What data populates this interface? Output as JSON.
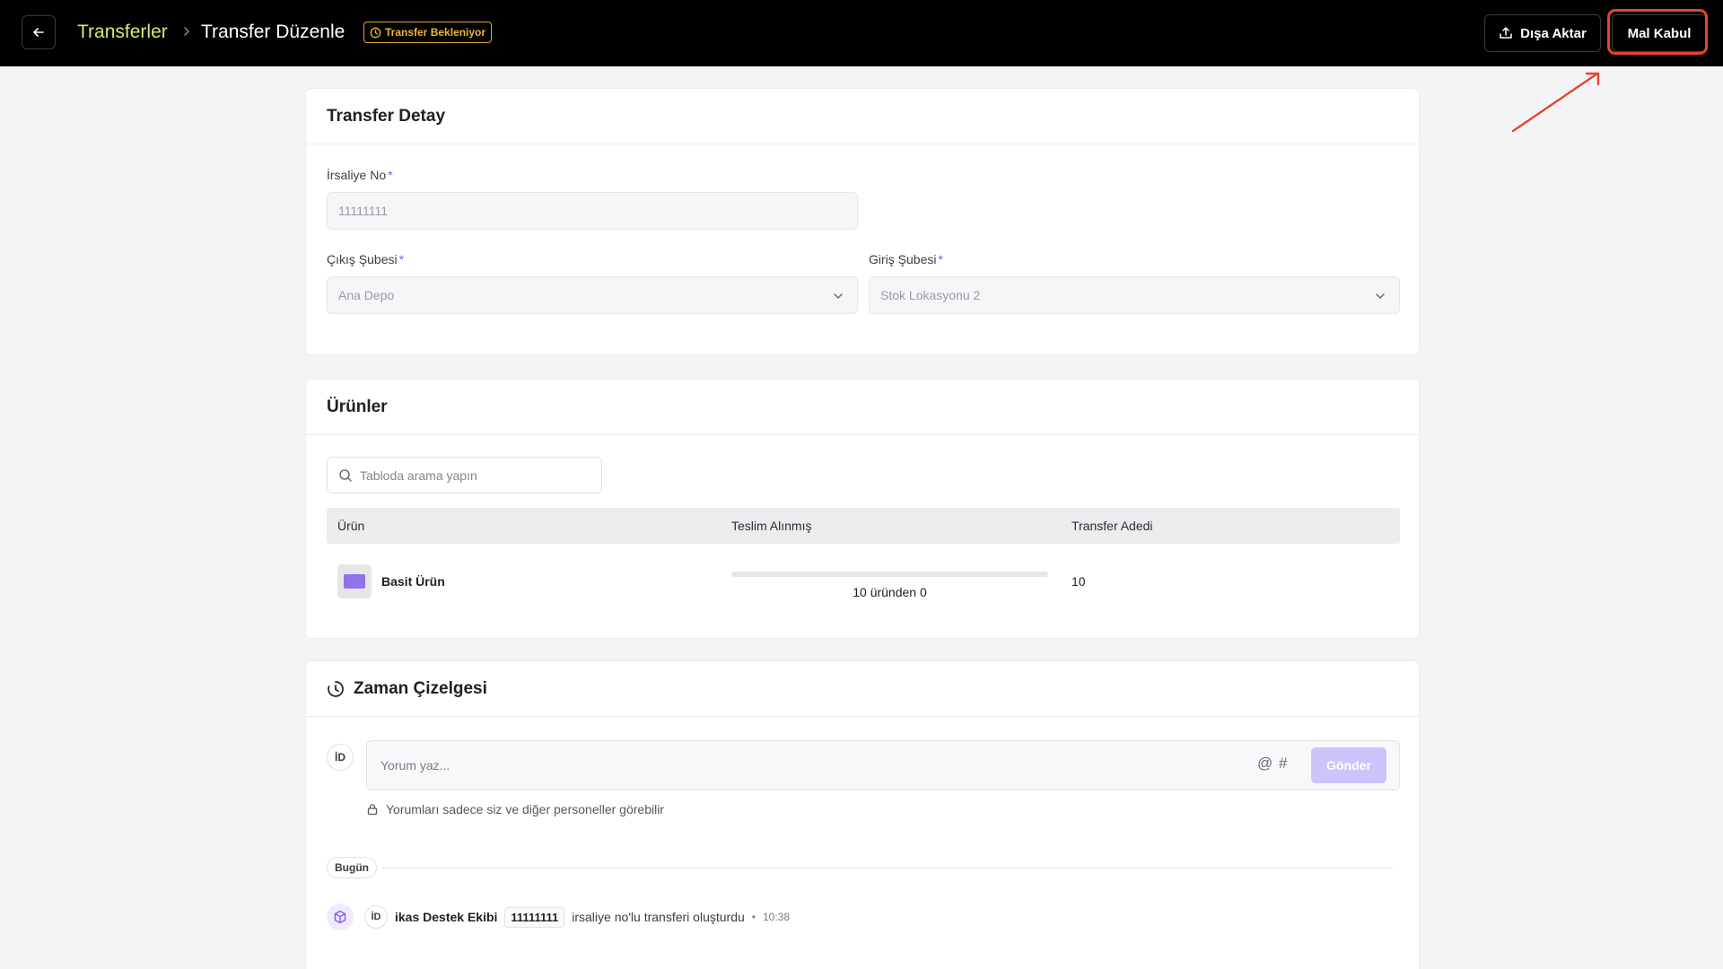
{
  "header": {
    "breadcrumb_root": "Transferler",
    "page_title": "Transfer Düzenle",
    "status_badge": "Transfer Bekleniyor",
    "export_label": "Dışa Aktar",
    "accept_label": "Mal Kabul"
  },
  "detail": {
    "title": "Transfer Detay",
    "waybill_label": "İrsaliye No",
    "waybill_value": "11111111",
    "from_label": "Çıkış Şubesi",
    "from_value": "Ana Depo",
    "to_label": "Giriş Şubesi",
    "to_value": "Stok Lokasyonu 2"
  },
  "products": {
    "title": "Ürünler",
    "search_placeholder": "Tabloda arama yapın",
    "columns": [
      "Ürün",
      "Teslim Alınmış",
      "Transfer Adedi"
    ],
    "rows": [
      {
        "name": "Basit Ürün",
        "received_label": "10 üründen 0",
        "received_fraction": 0,
        "quantity": "10"
      }
    ]
  },
  "timeline": {
    "title": "Zaman Çizelgesi",
    "user_initials": "İD",
    "comment_placeholder": "Yorum yaz...",
    "at_symbol": "@",
    "hash_symbol": "#",
    "send_label": "Gönder",
    "privacy_note": "Yorumları sadece siz ve diğer personeller görebilir",
    "day_label": "Bugün",
    "events": [
      {
        "initials": "İD",
        "user": "ikas Destek Ekibi",
        "code": "11111111",
        "text": "irsaliye no'lu transferi oluşturdu",
        "separator": "•",
        "time": "10:38"
      }
    ]
  },
  "colors": {
    "accent": "#7b5cf0",
    "breadcrumb": "#d7e96a",
    "status": "#f0b53b",
    "highlight": "#e8442b"
  }
}
